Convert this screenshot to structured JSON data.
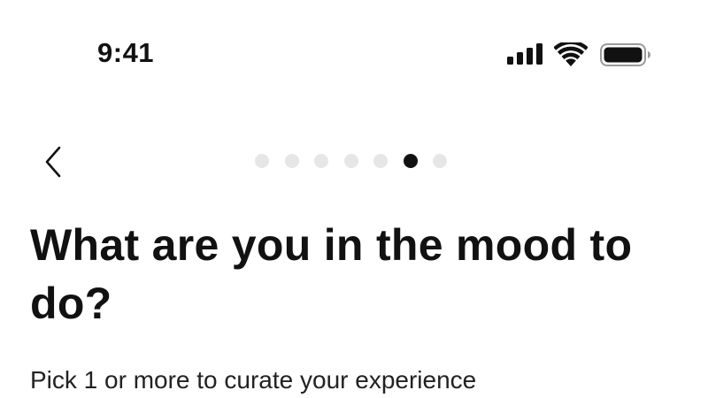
{
  "status_bar": {
    "time": "9:41",
    "icons": [
      "signal-icon",
      "wifi-icon",
      "battery-icon"
    ]
  },
  "navigation": {
    "back_icon": "chevron-left-icon",
    "progress": {
      "total_steps": 7,
      "current_step": 6
    }
  },
  "main": {
    "title": "What are you in the mood to do?",
    "subtitle": "Pick 1 or more to curate your experience"
  },
  "colors": {
    "text": "#111111",
    "dot_inactive": "#e6e6e6",
    "dot_active": "#111111",
    "background": "#ffffff"
  }
}
